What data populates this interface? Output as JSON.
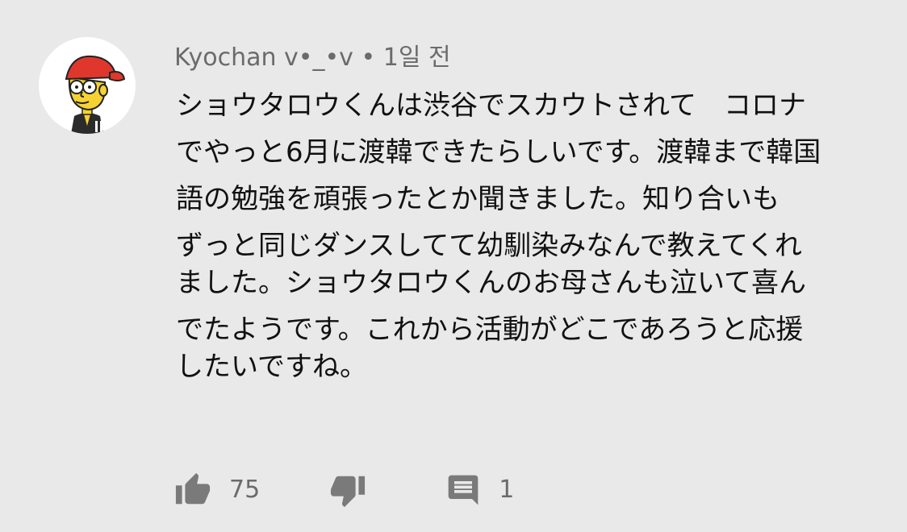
{
  "comment": {
    "author": "Kyochan v•_•v",
    "separator": "•",
    "timestamp": "1일 전",
    "text_lines": [
      "ショウタロウくんは渋谷でスカウトされて　コロナ",
      "でやっと6月に渡韓できたらしいです。渡韓まで韓国",
      "語の勉強を頑張ったとか聞きました。知り合いも",
      "ずっと同じダンスしてて幼馴染みなんで教えてくれ",
      "ました。ショウタロウくんのお母さんも泣いて喜ん",
      "でたようです。これから活動がどこであろうと応援",
      "したいですね。"
    ],
    "like_count": "75",
    "reply_count": "1"
  },
  "colors": {
    "background": "#e9e9e9",
    "meta_text": "#6b6b6b",
    "body_text": "#111111",
    "icon": "#7a7a7a",
    "avatar_cap": "#e0372c",
    "avatar_skin": "#f5d233"
  },
  "icons": {
    "like": "thumbs-up-icon",
    "dislike": "thumbs-down-icon",
    "reply": "comment-icon"
  }
}
